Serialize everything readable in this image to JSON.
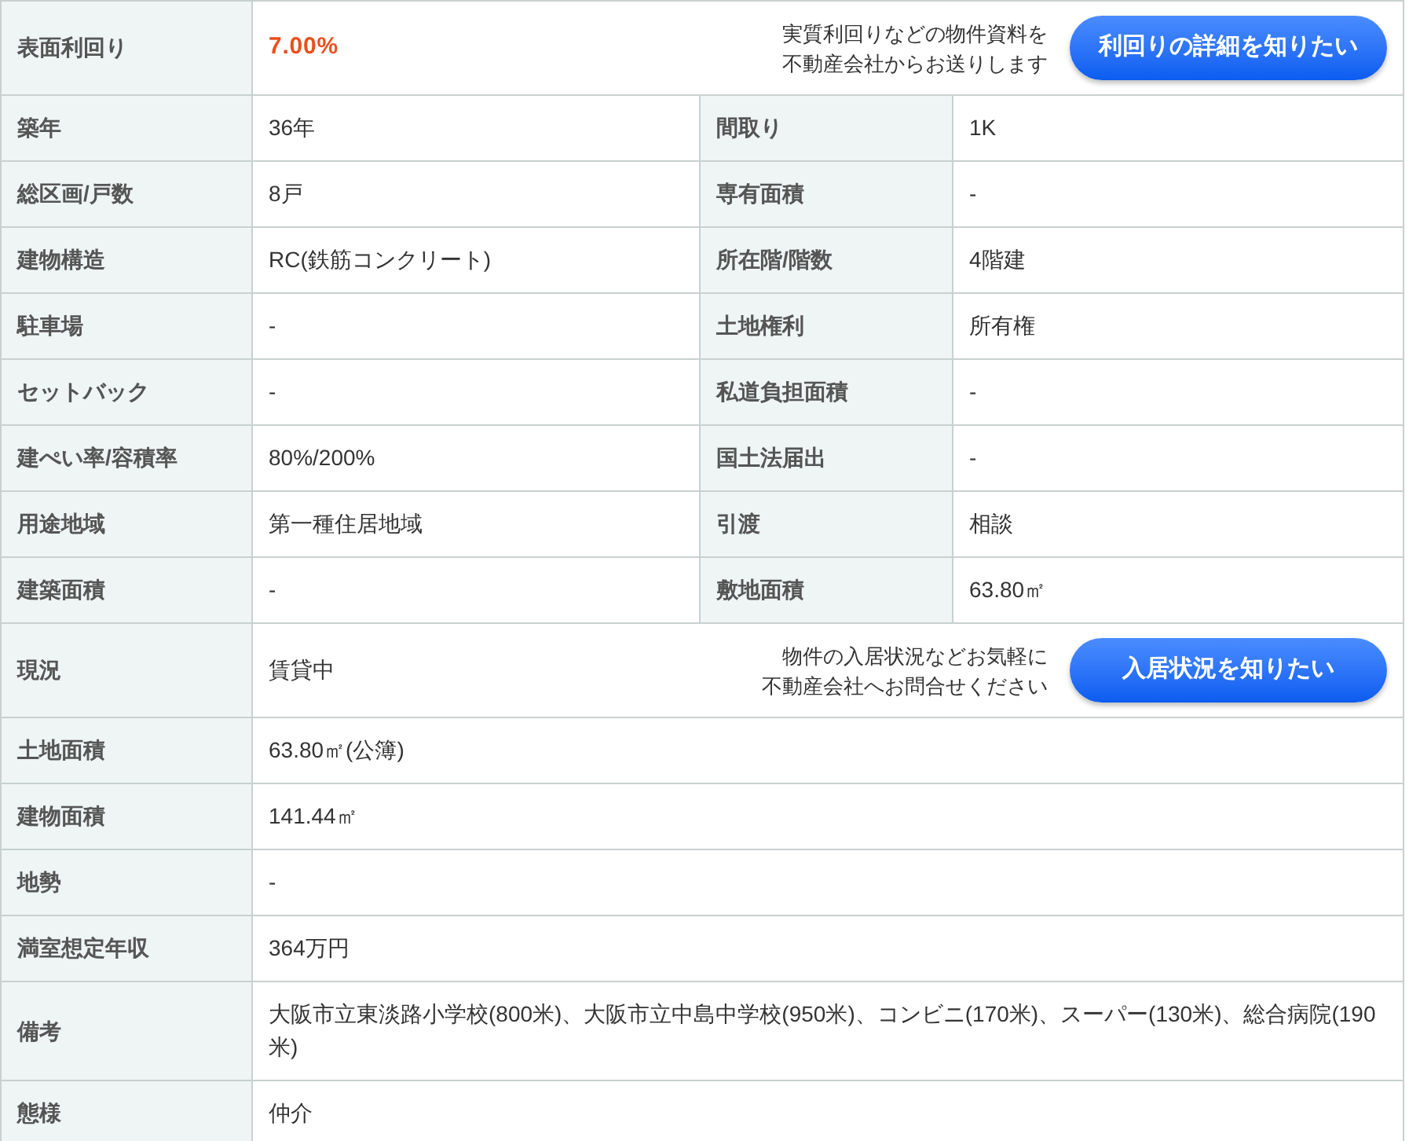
{
  "rows": [
    {
      "kind": "action",
      "label": "表面利回り",
      "value": "7.00%",
      "highlight": true,
      "note": [
        "実質利回りなどの物件資料を",
        "不動産会社からお送りします"
      ],
      "button": "利回りの詳細を知りたい"
    },
    {
      "kind": "pair",
      "cells": [
        {
          "label": "築年",
          "value": "36年"
        },
        {
          "label": "間取り",
          "value": "1K"
        }
      ]
    },
    {
      "kind": "pair",
      "cells": [
        {
          "label": "総区画/戸数",
          "value": "8戸"
        },
        {
          "label": "専有面積",
          "value": "-"
        }
      ]
    },
    {
      "kind": "pair",
      "cells": [
        {
          "label": "建物構造",
          "value": "RC(鉄筋コンクリート)"
        },
        {
          "label": "所在階/階数",
          "value": "4階建"
        }
      ]
    },
    {
      "kind": "pair",
      "cells": [
        {
          "label": "駐車場",
          "value": "-"
        },
        {
          "label": "土地権利",
          "value": "所有権"
        }
      ]
    },
    {
      "kind": "pair",
      "cells": [
        {
          "label": "セットバック",
          "value": "-"
        },
        {
          "label": "私道負担面積",
          "value": "-"
        }
      ]
    },
    {
      "kind": "pair",
      "cells": [
        {
          "label": "建ぺい率/容積率",
          "value": "80%/200%"
        },
        {
          "label": "国土法届出",
          "value": "-"
        }
      ]
    },
    {
      "kind": "pair",
      "cells": [
        {
          "label": "用途地域",
          "value": "第一種住居地域"
        },
        {
          "label": "引渡",
          "value": "相談"
        }
      ]
    },
    {
      "kind": "pair",
      "cells": [
        {
          "label": "建築面積",
          "value": "-"
        },
        {
          "label": "敷地面積",
          "value": "63.80㎡"
        }
      ]
    },
    {
      "kind": "action",
      "label": "現況",
      "value": "賃貸中",
      "highlight": false,
      "note": [
        "物件の入居状況などお気軽に",
        "不動産会社へお問合せください"
      ],
      "button": "入居状況を知りたい"
    },
    {
      "kind": "single",
      "label": "土地面積",
      "value": "63.80㎡(公簿)"
    },
    {
      "kind": "single",
      "label": "建物面積",
      "value": "141.44㎡"
    },
    {
      "kind": "single",
      "label": "地勢",
      "value": "-"
    },
    {
      "kind": "single",
      "label": "満室想定年収",
      "value": "364万円"
    },
    {
      "kind": "single",
      "label": "備考",
      "value": "大阪市立東淡路小学校(800米)、大阪市立中島中学校(950米)、コンビニ(170米)、スーパー(130米)、総合病院(190米)"
    },
    {
      "kind": "single",
      "label": "態様",
      "value": "仲介"
    }
  ]
}
